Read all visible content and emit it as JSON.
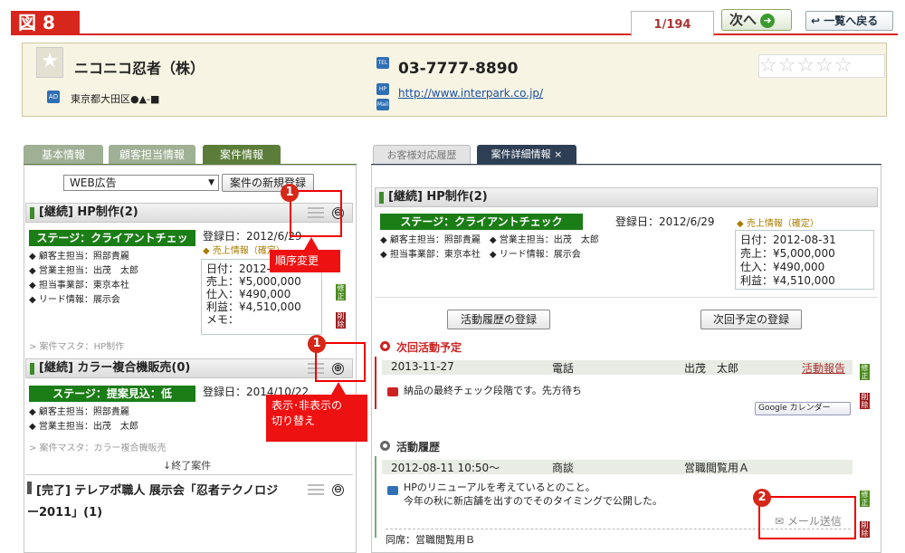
{
  "figure_label": "図 8",
  "pager": {
    "position": "1/194"
  },
  "nav": {
    "next_label": "次へ",
    "back_label": "一覧へ戻る"
  },
  "company": {
    "name": "ニコニコ忍者（株）",
    "address": "東京都大田区●▲-■",
    "tel": "03-7777-8890",
    "url": "http://www.interpark.co.jp/",
    "rating_stars": "☆☆☆☆☆",
    "icons": {
      "ad": "AD",
      "tel": "TEL",
      "hp": "HP",
      "mail": "Mail"
    }
  },
  "left_tabs": [
    "基本情報",
    "顧客担当情報",
    "案件情報"
  ],
  "right_tabs": [
    "お客様対応履歴",
    "案件詳細情報",
    "×"
  ],
  "left": {
    "select_value": "WEB広告",
    "new_button": "案件の新規登録",
    "deal1": {
      "title": "[継続] HP制作(2)",
      "stage": "ステージ：クライアントチェッ",
      "reg_date": "登録日：2012/6/29",
      "sales_info": "◆ 売上情報（確定）",
      "fields": [
        "◆ 顧客主担当：照部貴麗",
        "◆ 営業主担当：出茂　太郎",
        "◆ 担当事業部：東京本社",
        "◆ リード情報：展示会"
      ],
      "fin": [
        "日付：2012-08-31",
        "売上：¥5,000,000",
        "仕入：¥490,000",
        "利益：¥4,510,000",
        "メモ："
      ],
      "master": "> 案件マスタ：HP制作"
    },
    "deal2": {
      "title": "[継続] カラー複合機販売(0)",
      "stage": "ステージ：提案見込：低",
      "reg_date": "登録日：2014/10/22",
      "fields": [
        "◆ 顧客主担当：照部貴麗",
        "◆ 営業主担当：出茂　太郎"
      ],
      "master": "> 案件マスタ：カラー複合機販売"
    },
    "ended_label": "↓終了案件",
    "deal3": {
      "title_line1": "[完了] テレアポ職人 展示会「忍者テクノロジ",
      "title_line2": "ー2011」(1)"
    },
    "side_btns": {
      "edit": "修正",
      "del": "削除"
    }
  },
  "annotations": {
    "n1": "1",
    "n2": "2",
    "reorder": "順序変更",
    "toggle_line1": "表示･非表示の",
    "toggle_line2": "切り替え"
  },
  "right": {
    "title": "[継続] HP制作(2)",
    "stage": "ステージ：クライアントチェック",
    "reg_date": "登録日：2012/6/29",
    "sales_info": "◆ 売上情報（確定）",
    "fields_row1": "◆ 顧客主担当：照部貴麗　◆ 営業主担当：出茂　太郎",
    "fields_row2": "◆ 担当事業部：東京本社　◆ リード情報：展示会",
    "fin": [
      "日付：2012-08-31",
      "売上：¥5,000,000",
      "仕入：¥490,000",
      "利益：¥4,510,000"
    ],
    "btn_activity": "活動履歴の登録",
    "btn_next": "次回予定の登録",
    "next_title": "次回活動予定",
    "next": {
      "date": "2013-11-27",
      "type": "電話",
      "person": "出茂　太郎",
      "report": "活動報告",
      "msg": "納品の最終チェック段階です。先方待ち",
      "gcal": "Google カレンダー"
    },
    "history_title": "活動履歴",
    "history": {
      "date": "2012-08-11 10:50～",
      "type": "商談",
      "person": "営職閲覧用Ａ",
      "msg1": "HPのリニューアルを考えているとのこと。",
      "msg2": "今年の秋に新店舗を出すのでそのタイミングで公開した。",
      "mail": "メール送信",
      "attendee": "同席：営職閲覧用Ｂ"
    },
    "side_btns": {
      "edit": "修正",
      "del": "削除"
    }
  }
}
